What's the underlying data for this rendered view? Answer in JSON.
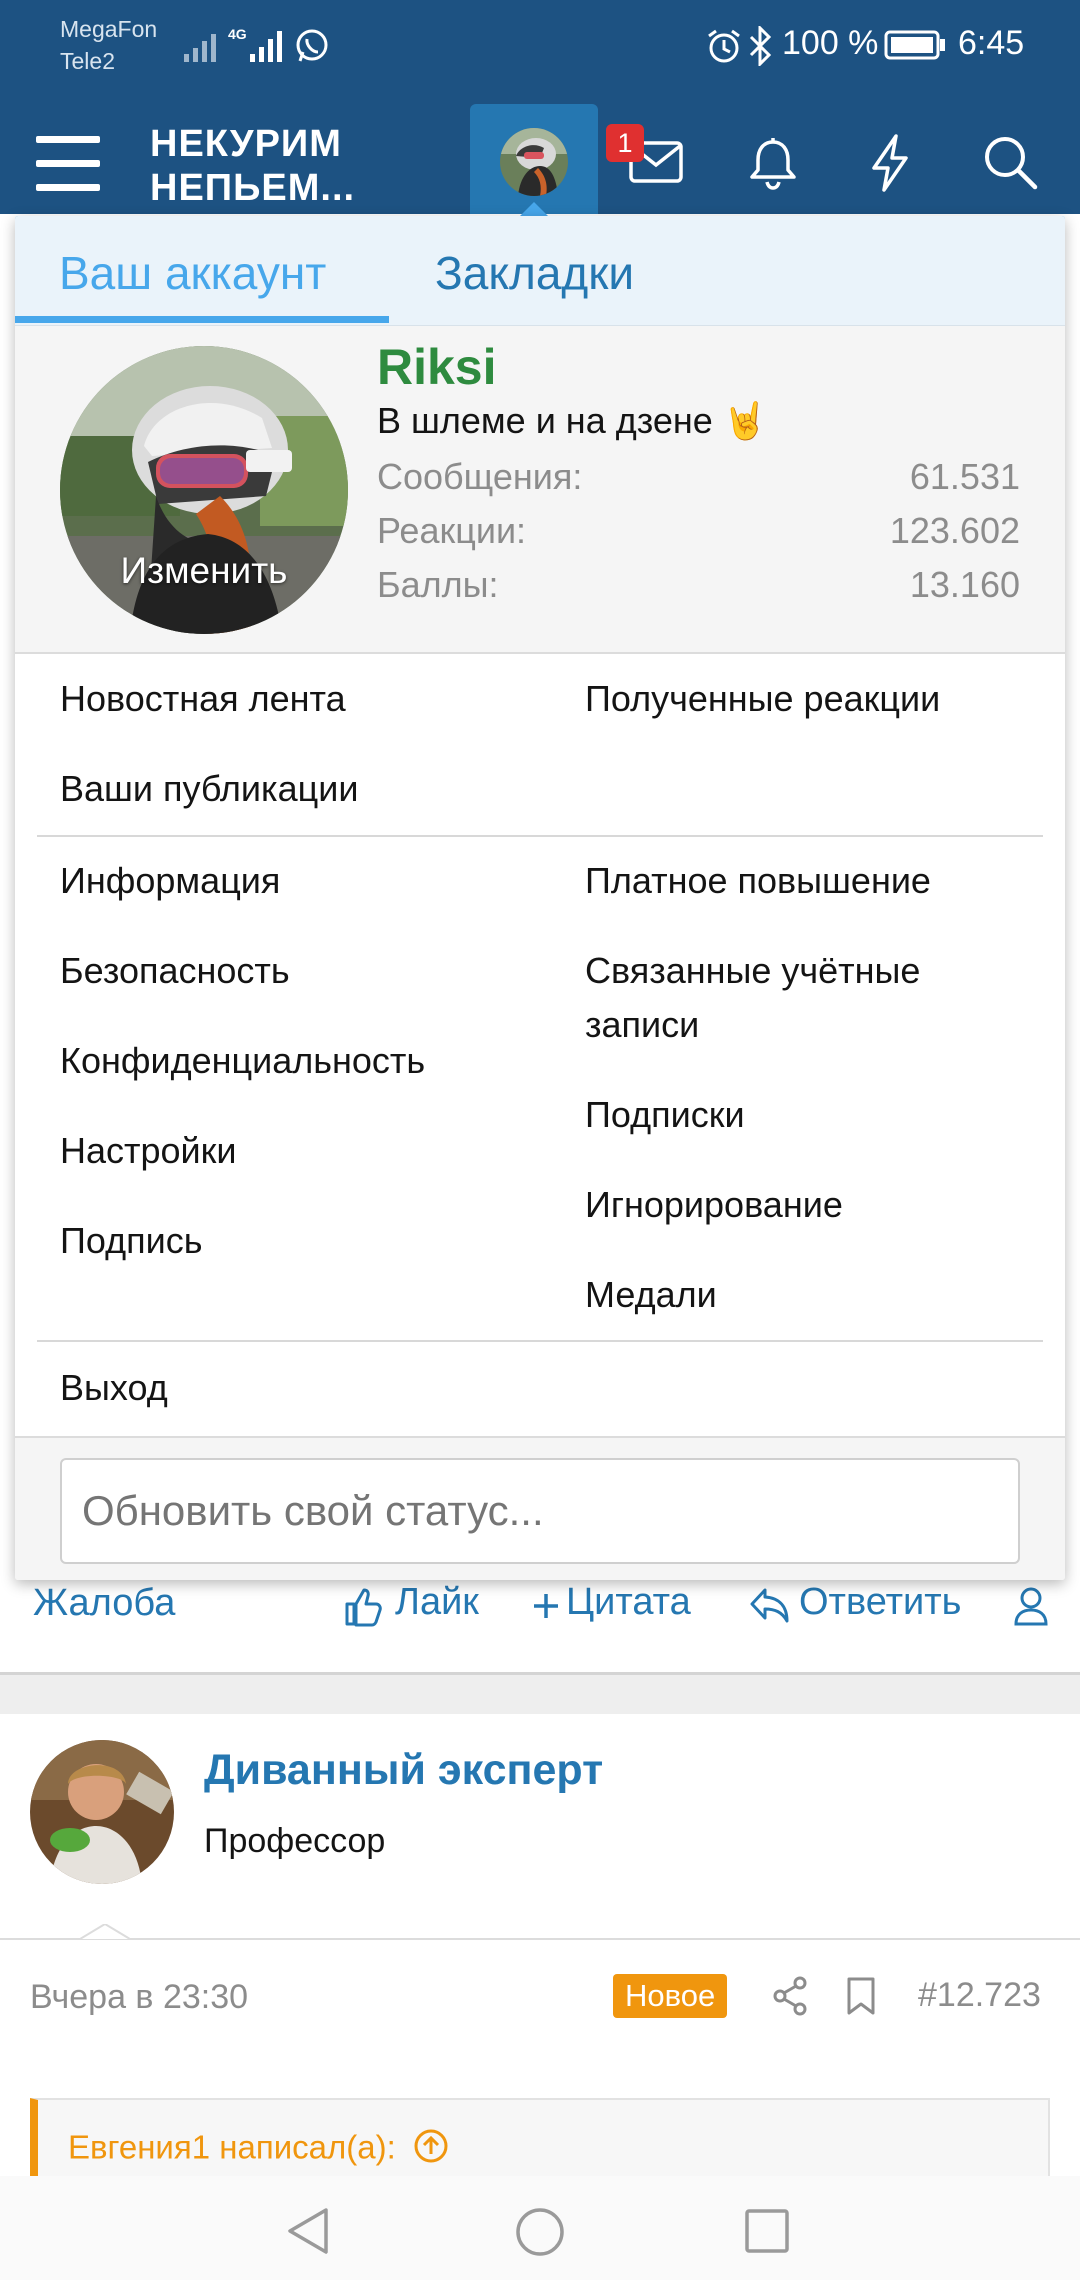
{
  "status_bar": {
    "carrier1": "MegaFon",
    "carrier2": "Tele2",
    "network": "4G",
    "battery": "100 %",
    "time": "6:45",
    "icons": [
      "signal-icon",
      "signal-4g-icon",
      "whatsapp-icon",
      "alarm-icon",
      "bluetooth-icon",
      "battery-icon"
    ]
  },
  "header": {
    "logo_line1": "НЕКУРИМ",
    "logo_line2": "НЕПЬЕМ...",
    "messages_badge": "1",
    "icons": [
      "menu-icon",
      "avatar",
      "envelope-icon",
      "bell-icon",
      "lightning-icon",
      "search-icon"
    ],
    "background": "#1d5282"
  },
  "menu": {
    "tabs": [
      "Ваш аккаунт",
      "Закладки"
    ],
    "active_tab": "Ваш аккаунт",
    "profile": {
      "username": "Riksi",
      "user_title": "В шлеме и на дзене 🤘",
      "change_label": "Изменить",
      "stats": [
        {
          "label": "Сообщения:",
          "value": "61.531"
        },
        {
          "label": "Реакции:",
          "value": "123.602"
        },
        {
          "label": "Баллы:",
          "value": "13.160"
        }
      ],
      "username_color": "#2e8b3f"
    },
    "group1_left": [
      "Новостная лента",
      "Ваши публикации"
    ],
    "group1_right": [
      "Полученные реакции"
    ],
    "group2_left": [
      "Информация",
      "Безопасность",
      "Конфиденциальность",
      "Настройки",
      "Подпись"
    ],
    "group2_right": [
      "Платное повышение",
      "Связанные учётные записи",
      "Подписки",
      "Игнорирование",
      "Медали"
    ],
    "logout": "Выход",
    "status_placeholder": "Обновить свой статус..."
  },
  "post_actions": {
    "report": "Жалоба",
    "like": "Лайк",
    "quote": "Цитата",
    "reply": "Ответить"
  },
  "next_post": {
    "author": "Диванный эксперт",
    "author_title": "Профессор",
    "date": "Вчера в 23:30",
    "new_badge": "Новое",
    "number": "#12.723",
    "quote_header": "Евгения1 написал(а):"
  },
  "colors": {
    "link": "#2577b1",
    "badge_new": "#f0960e",
    "quote_accent": "#f0960e"
  }
}
